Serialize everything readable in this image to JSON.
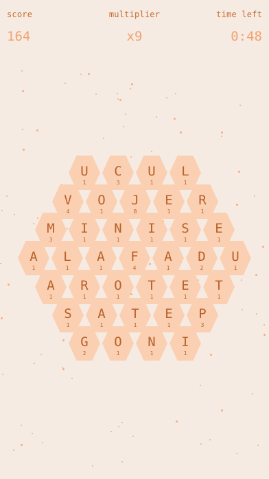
{
  "hud": {
    "score_label": "score",
    "score_value": "164",
    "multiplier_label": "multiplier",
    "multiplier_value": "x9",
    "time_label": "time left",
    "time_value": "0:48"
  },
  "board": {
    "rows": [
      [
        {
          "l": "U",
          "p": "1"
        },
        {
          "l": "C",
          "p": "3"
        },
        {
          "l": "U",
          "p": "1"
        },
        {
          "l": "L",
          "p": "1"
        }
      ],
      [
        {
          "l": "V",
          "p": "4"
        },
        {
          "l": "O",
          "p": "1"
        },
        {
          "l": "J",
          "p": "8"
        },
        {
          "l": "E",
          "p": "1"
        },
        {
          "l": "R",
          "p": "1"
        }
      ],
      [
        {
          "l": "M",
          "p": "3"
        },
        {
          "l": "I",
          "p": "1"
        },
        {
          "l": "N",
          "p": "1"
        },
        {
          "l": "I",
          "p": "1"
        },
        {
          "l": "S",
          "p": "1"
        },
        {
          "l": "E",
          "p": "1"
        }
      ],
      [
        {
          "l": "A",
          "p": "1"
        },
        {
          "l": "L",
          "p": "1"
        },
        {
          "l": "A",
          "p": "1"
        },
        {
          "l": "F",
          "p": "4"
        },
        {
          "l": "A",
          "p": "1"
        },
        {
          "l": "D",
          "p": "2"
        },
        {
          "l": "U",
          "p": "1"
        }
      ],
      [
        {
          "l": "A",
          "p": "1"
        },
        {
          "l": "R",
          "p": "1"
        },
        {
          "l": "O",
          "p": "1"
        },
        {
          "l": "T",
          "p": "1"
        },
        {
          "l": "E",
          "p": "1"
        },
        {
          "l": "T",
          "p": "1"
        }
      ],
      [
        {
          "l": "S",
          "p": "1"
        },
        {
          "l": "A",
          "p": "1"
        },
        {
          "l": "T",
          "p": "1"
        },
        {
          "l": "E",
          "p": "1"
        },
        {
          "l": "P",
          "p": "3"
        }
      ],
      [
        {
          "l": "G",
          "p": "2"
        },
        {
          "l": "O",
          "p": "1"
        },
        {
          "l": "N",
          "p": "1"
        },
        {
          "l": "I",
          "p": "1"
        }
      ]
    ]
  },
  "colors": {
    "background": "#f6ebe3",
    "tile": "#fbd0b2",
    "tile_text": "#b8612a",
    "hud_label": "#c8692a",
    "hud_value": "#f3a271"
  }
}
